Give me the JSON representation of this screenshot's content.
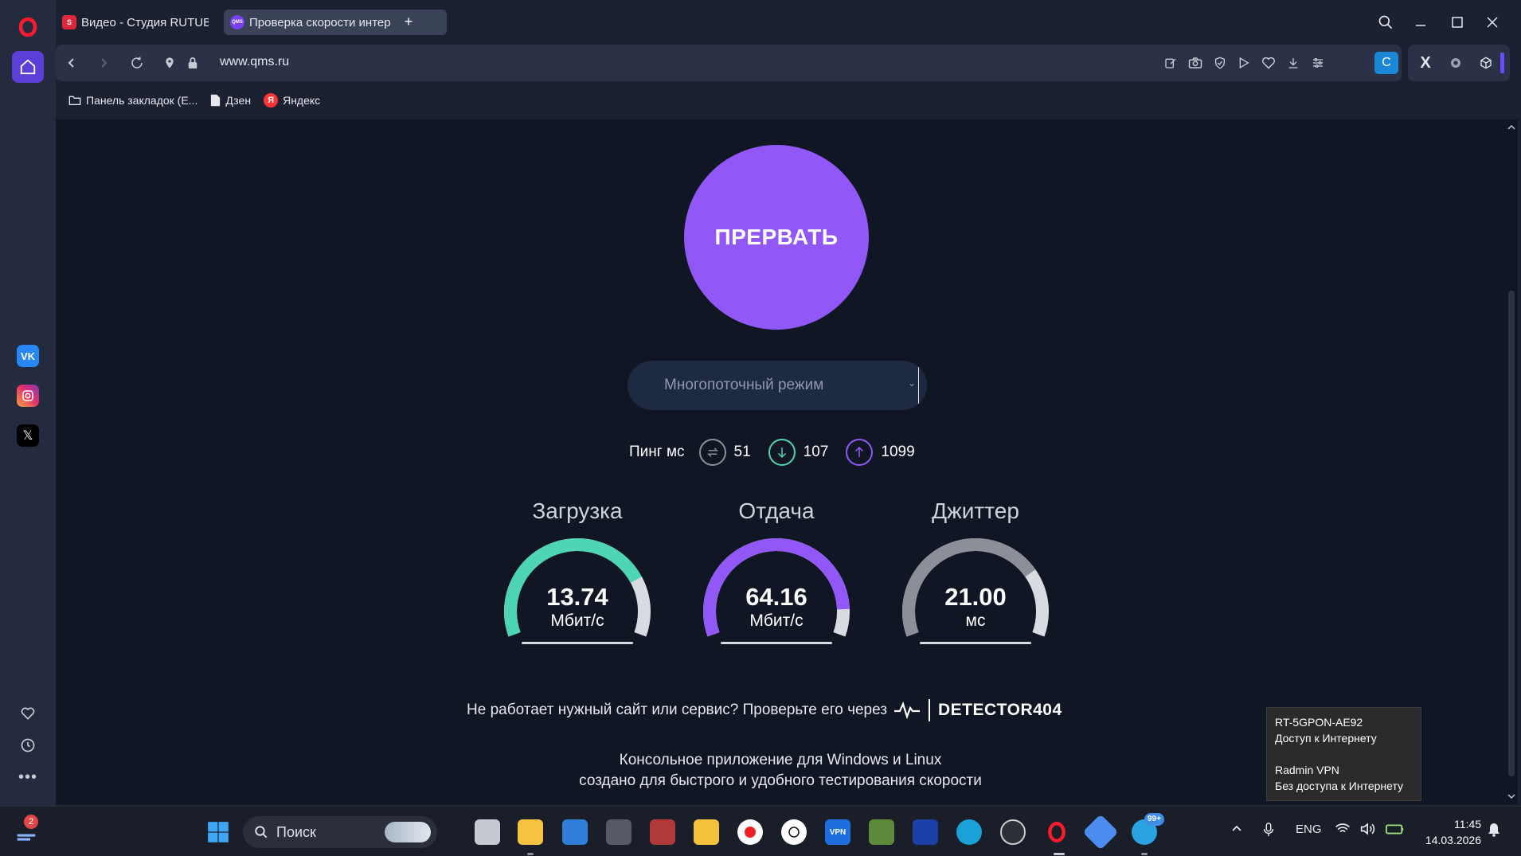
{
  "tabs": [
    {
      "label": "Видео - Студия RUTUBE",
      "favicon": "S"
    },
    {
      "label": "Проверка скорости интер",
      "favicon": "QMS"
    }
  ],
  "address": {
    "url": "www.qms.ru",
    "extension_label": "C"
  },
  "bookmarks": [
    {
      "label": "Панель закладок (Е..."
    },
    {
      "label": "Дзен"
    },
    {
      "label": "Яндекс",
      "icon_letter": "Я"
    }
  ],
  "sidebar": {
    "vk_label": "VK",
    "x_label": "𝕏"
  },
  "speedtest": {
    "stop_button": "ПРЕРВАТЬ",
    "mode_select": "Многопоточный режим",
    "ping_label": "Пинг мс",
    "ping_values": [
      "51",
      "107",
      "1099"
    ],
    "gauges": [
      {
        "title": "Загрузка",
        "value": "13.74",
        "unit": "Мбит/с",
        "fill": 0.78,
        "color": "#4ed6b4"
      },
      {
        "title": "Отдача",
        "value": "64.16",
        "unit": "Мбит/с",
        "fill": 0.9,
        "color": "#9158f7"
      },
      {
        "title": "Джиттер",
        "value": "21.00",
        "unit": "мс",
        "fill": 0.75,
        "color": "#8c8f98"
      }
    ],
    "detector_text": "Не работает нужный сайт или сервис? Проверьте его через",
    "detector_brand": "DETECTOR404",
    "console_line1": "Консольное приложение для Windows и Linux",
    "console_line2": "создано для быстрого и удобного тестирования скорости"
  },
  "network_tooltip": {
    "net1_name": "RT-5GPON-AE92",
    "net1_status": "Доступ к Интернету",
    "net2_name": "Radmin VPN",
    "net2_status": "Без доступа к Интернету"
  },
  "taskbar": {
    "search_placeholder": "Поиск",
    "notif_count": "2",
    "telegram_badge": "99+",
    "vpn_label": "VPN",
    "lang": "ENG",
    "time": "11:45",
    "date": "14.03.2026"
  },
  "colors": {
    "accent": "#9158f7",
    "download": "#4ed6b4",
    "page_bg": "#101624"
  }
}
